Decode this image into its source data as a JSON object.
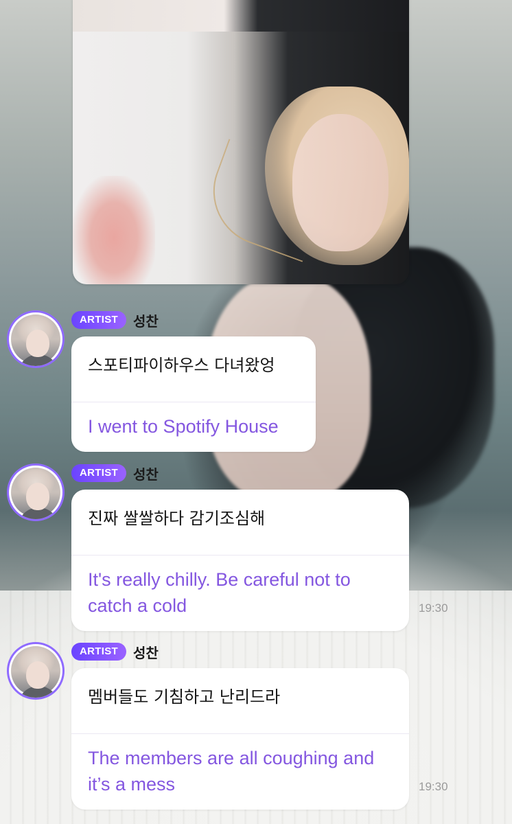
{
  "chat": {
    "messages": [
      {
        "badge": "ARTIST",
        "sender": "성찬",
        "original": "스포티파이하우스 다녀왔엉",
        "translation": "I went to Spotify House",
        "time": ""
      },
      {
        "badge": "ARTIST",
        "sender": "성찬",
        "original": "진짜 쌀쌀하다 감기조심해",
        "translation": "It's really chilly. Be careful not to catch a cold",
        "time": "19:30"
      },
      {
        "badge": "ARTIST",
        "sender": "성찬",
        "original": "멤버들도 기침하고 난리드라",
        "translation": "The members are all coughing and it’s a mess",
        "time": "19:30"
      }
    ]
  },
  "colors": {
    "badge_gradient_start": "#6a44ff",
    "badge_gradient_end": "#9a62ff",
    "translation_text": "#8457e0",
    "avatar_ring": "#8f6bff",
    "timestamp": "#9a9a9a"
  }
}
